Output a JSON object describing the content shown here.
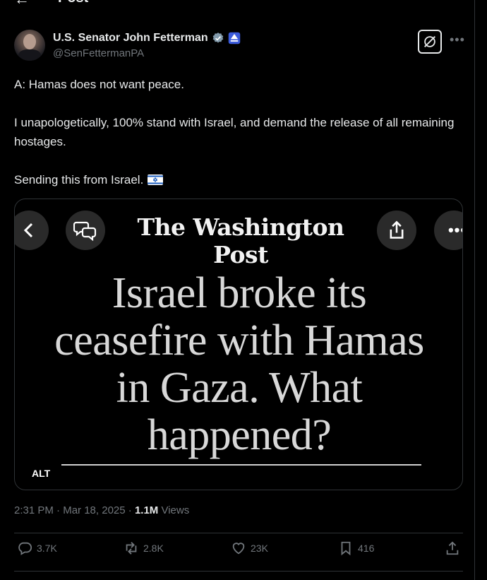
{
  "header": {
    "title": "Post",
    "back_icon": "arrow-left-icon"
  },
  "author": {
    "name": "U.S. Senator John Fetterman",
    "handle": "@SenFettermanPA",
    "verified_icon": "verified-badge-icon",
    "affiliation_icon": "government-badge-icon"
  },
  "tweet": {
    "line1": "A:  Hamas does not want peace.",
    "line2": "I unapologetically, 100% stand with Israel, and demand the release of all remaining hostages.",
    "line3": "Sending this from Israel.",
    "flag_icon": "israel-flag-icon"
  },
  "media": {
    "publication": "The Washington Post",
    "headline_lines": [
      "Israel broke its",
      "ceasefire with Hamas",
      "in Gaza. What",
      "happened?"
    ],
    "alt_badge": "ALT"
  },
  "meta": {
    "time": "2:31 PM",
    "sep1": " · ",
    "date": "Mar 18, 2025",
    "sep2": " · ",
    "views_count": "1.1M",
    "views_label": " Views"
  },
  "actions": {
    "replies": "3.7K",
    "reposts": "2.8K",
    "likes": "23K",
    "bookmarks": "416"
  },
  "colors": {
    "background": "#000000",
    "text": "#e7e9ea",
    "muted": "#71767b",
    "border": "#2f3336",
    "verified": "#829aab"
  }
}
